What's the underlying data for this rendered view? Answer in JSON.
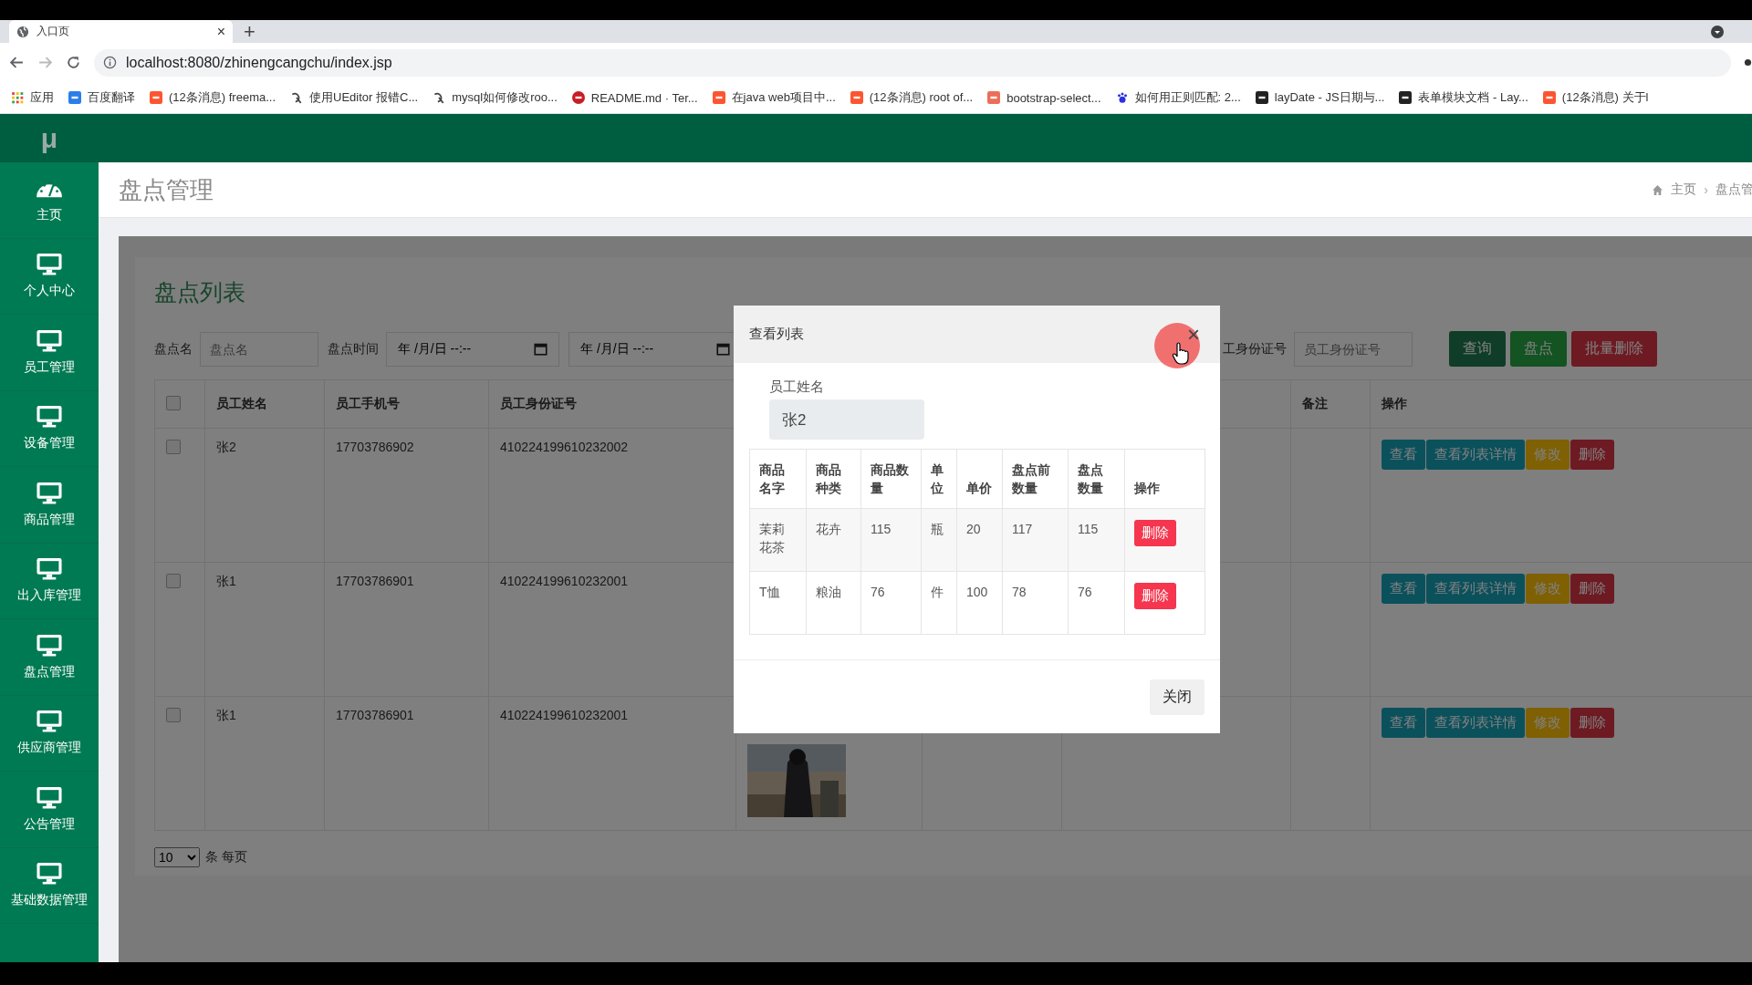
{
  "browser": {
    "tab_title": "入口页",
    "tab_close": "×",
    "new_tab": "+",
    "url": "localhost:8080/zhinengcangchu/index.jsp",
    "bookmarks": [
      {
        "label": "应用",
        "kind": "apps"
      },
      {
        "label": "百度翻译",
        "kind": "translate"
      },
      {
        "label": "(12条消息) freema...",
        "kind": "csdn"
      },
      {
        "label": "使用UEditor 报错C...",
        "kind": "swirl"
      },
      {
        "label": "mysql如何修改roo...",
        "kind": "swirl"
      },
      {
        "label": "README.md · Ter...",
        "kind": "gitee"
      },
      {
        "label": "在java web项目中...",
        "kind": "csdn"
      },
      {
        "label": "(12条消息) root of...",
        "kind": "csdn"
      },
      {
        "label": "bootstrap-select...",
        "kind": "jianshu"
      },
      {
        "label": "如何用正则匹配: 2...",
        "kind": "baidu"
      },
      {
        "label": "layDate - JS日期与...",
        "kind": "layui"
      },
      {
        "label": "表单模块文档 - Lay...",
        "kind": "layui"
      },
      {
        "label": "(12条消息) 关于l",
        "kind": "csdn"
      }
    ]
  },
  "sidebar": {
    "logo": "μ",
    "items": [
      {
        "label": "主页",
        "kind": "dashboard"
      },
      {
        "label": "个人中心",
        "kind": "monitor"
      },
      {
        "label": "员工管理",
        "kind": "monitor"
      },
      {
        "label": "设备管理",
        "kind": "monitor"
      },
      {
        "label": "商品管理",
        "kind": "monitor"
      },
      {
        "label": "出入库管理",
        "kind": "monitor"
      },
      {
        "label": "盘点管理",
        "kind": "monitor"
      },
      {
        "label": "供应商管理",
        "kind": "monitor"
      },
      {
        "label": "公告管理",
        "kind": "monitor"
      },
      {
        "label": "基础数据管理",
        "kind": "monitor"
      }
    ]
  },
  "page": {
    "title": "盘点管理",
    "breadcrumb": [
      "主页",
      "›",
      "盘点管"
    ]
  },
  "list": {
    "title": "盘点列表",
    "filters": [
      {
        "kind": "text",
        "label": "盘点名",
        "placeholder": "盘点名"
      },
      {
        "kind": "datetime",
        "label": "盘点时间",
        "value": "年 /月/日 --:--"
      },
      {
        "kind": "datetime",
        "value": "年 /月/日 --:--"
      },
      {
        "kind": "text",
        "label": "工身份证号",
        "placeholder": "员工身份证号"
      }
    ],
    "buttons": [
      {
        "label": "查询",
        "kind": "primary"
      },
      {
        "label": "盘点",
        "kind": "success"
      },
      {
        "label": "批量删除",
        "kind": "danger"
      }
    ],
    "select_all": {
      "checked": false
    },
    "columns": [
      "员工姓名",
      "员工手机号",
      "员工身份证号",
      "备注",
      "操作"
    ],
    "rows": [
      {
        "checked": false,
        "name": "张2",
        "phone": "17703786902",
        "id_card": "410224199610232002",
        "actions": [
          {
            "label": "查看",
            "kind": "info"
          },
          {
            "label": "查看列表详情",
            "kind": "info"
          },
          {
            "label": "修改",
            "kind": "warning"
          },
          {
            "label": "删除",
            "kind": "danger"
          }
        ]
      },
      {
        "checked": false,
        "name": "张1",
        "phone": "17703786901",
        "id_card": "410224199610232001",
        "actions": [
          {
            "label": "查看",
            "kind": "info"
          },
          {
            "label": "查看列表详情",
            "kind": "info"
          },
          {
            "label": "修改",
            "kind": "warning"
          },
          {
            "label": "删除",
            "kind": "danger"
          }
        ]
      },
      {
        "checked": false,
        "name": "张1",
        "phone": "17703786901",
        "id_card": "410224199610232001",
        "photo": {
          "kind": "picture"
        },
        "actions": [
          {
            "label": "查看",
            "kind": "info"
          },
          {
            "label": "查看列表详情",
            "kind": "info"
          },
          {
            "label": "修改",
            "kind": "warning"
          },
          {
            "label": "删除",
            "kind": "danger"
          }
        ]
      }
    ],
    "page_size": {
      "value": "10",
      "suffix": "条 每页"
    }
  },
  "modal": {
    "title": "查看列表",
    "close": "×",
    "field": {
      "label": "员工姓名",
      "value": "张2"
    },
    "columns": [
      "商品名字",
      "商品种类",
      "商品数量",
      "单位",
      "单价",
      "盘点前数量",
      "盘点数量",
      "操作"
    ],
    "rows": [
      {
        "cells": [
          "茉莉花茶",
          "花卉",
          "115",
          "瓶",
          "20",
          "117",
          "115"
        ],
        "action": "删除"
      },
      {
        "cells": [
          "T恤",
          "粮油",
          "76",
          "件",
          "100",
          "78",
          "76"
        ],
        "action": "删除"
      }
    ],
    "footer_button": "关闭"
  }
}
